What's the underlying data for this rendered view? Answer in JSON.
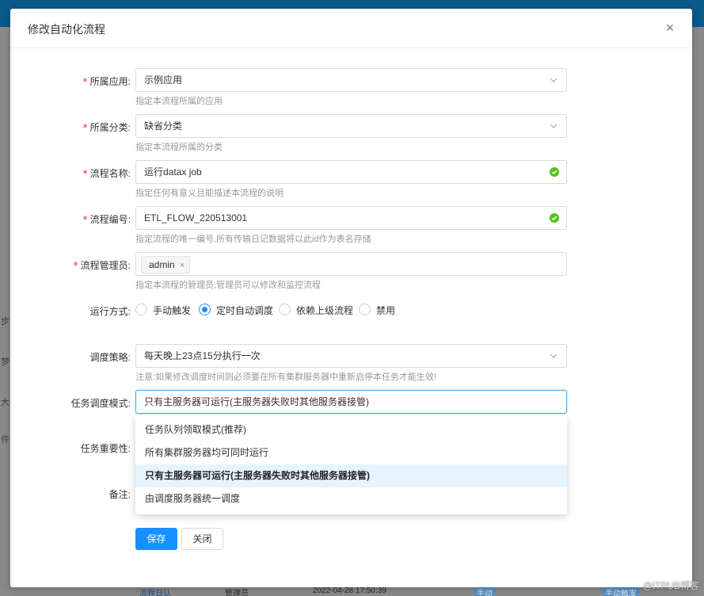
{
  "background": {
    "edge_texts": [
      "步",
      "梦",
      "大",
      "件"
    ],
    "bottom_row": {
      "link": "流程日认",
      "owner": "管理员",
      "time": "2022-04-28 17:50:39",
      "tag1": "手动",
      "tag2": "手动触发"
    }
  },
  "modal": {
    "title": "修改自动化流程",
    "close_symbol": "×"
  },
  "form": {
    "app": {
      "label": "所属应用:",
      "value": "示例应用",
      "hint": "指定本流程所属的应用"
    },
    "category": {
      "label": "所属分类:",
      "value": "缺省分类",
      "hint": "指定本流程所属的分类"
    },
    "name": {
      "label": "流程名称:",
      "value": "运行datax job",
      "hint": "指定任何有意义且能描述本流程的说明"
    },
    "code": {
      "label": "流程编号:",
      "value": "ETL_FLOW_220513001",
      "hint": "指定流程的唯一编号,所有传输日记数据将以此id作为表名存储"
    },
    "admin": {
      "label": "流程管理员:",
      "tag": "admin",
      "tag_close": "×",
      "hint": "指定本流程的管理员,管理员可以修改和监控流程"
    },
    "run_mode": {
      "label": "运行方式:",
      "options": [
        "手动触发",
        "定时自动调度",
        "依赖上级流程",
        "禁用"
      ],
      "selected": "定时自动调度"
    },
    "schedule": {
      "label": "调度策略:",
      "value": "每天晚上23点15分执行一次",
      "warning": "注意:如果修改调度时间则必须要在所有集群服务器中重新启停本任务才能生效!"
    },
    "task_mode": {
      "label": "任务调度模式:",
      "value": "只有主服务器可运行(主服务器失败时其他服务器接管)",
      "options": [
        "任务队列领取模式(推荐)",
        "所有集群服务器均可同时运行",
        "只有主服务器可运行(主服务器失败时其他服务器接管)",
        "由调度服务器统一调度"
      ],
      "selected_index": 2
    },
    "importance": {
      "label": "任务重要性:"
    },
    "remark": {
      "label": "备注:"
    }
  },
  "buttons": {
    "save": "保存",
    "close": "关闭"
  },
  "watermark": "@ITPUB博客",
  "colors": {
    "primary": "#1890ff",
    "required": "#f5222d",
    "success": "#52c41a",
    "option_selected_bg": "#e6f4ff"
  },
  "icons": {
    "select": "chevron-down-icon",
    "valid": "check-circle-icon",
    "close": "close-icon"
  }
}
